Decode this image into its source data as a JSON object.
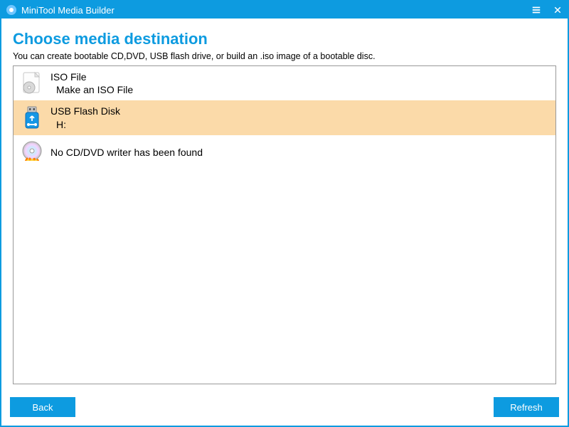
{
  "window": {
    "title": "MiniTool Media Builder"
  },
  "header": {
    "title": "Choose media destination",
    "subtitle": "You can create bootable CD,DVD, USB flash drive, or build an .iso image of a bootable disc."
  },
  "list": {
    "items": [
      {
        "title": "ISO File",
        "detail": "Make an ISO File",
        "selected": false
      },
      {
        "title": "USB Flash Disk",
        "detail": "H:",
        "selected": true
      },
      {
        "title": "No CD/DVD writer has been found",
        "detail": "",
        "selected": false
      }
    ]
  },
  "footer": {
    "back_label": "Back",
    "refresh_label": "Refresh"
  }
}
